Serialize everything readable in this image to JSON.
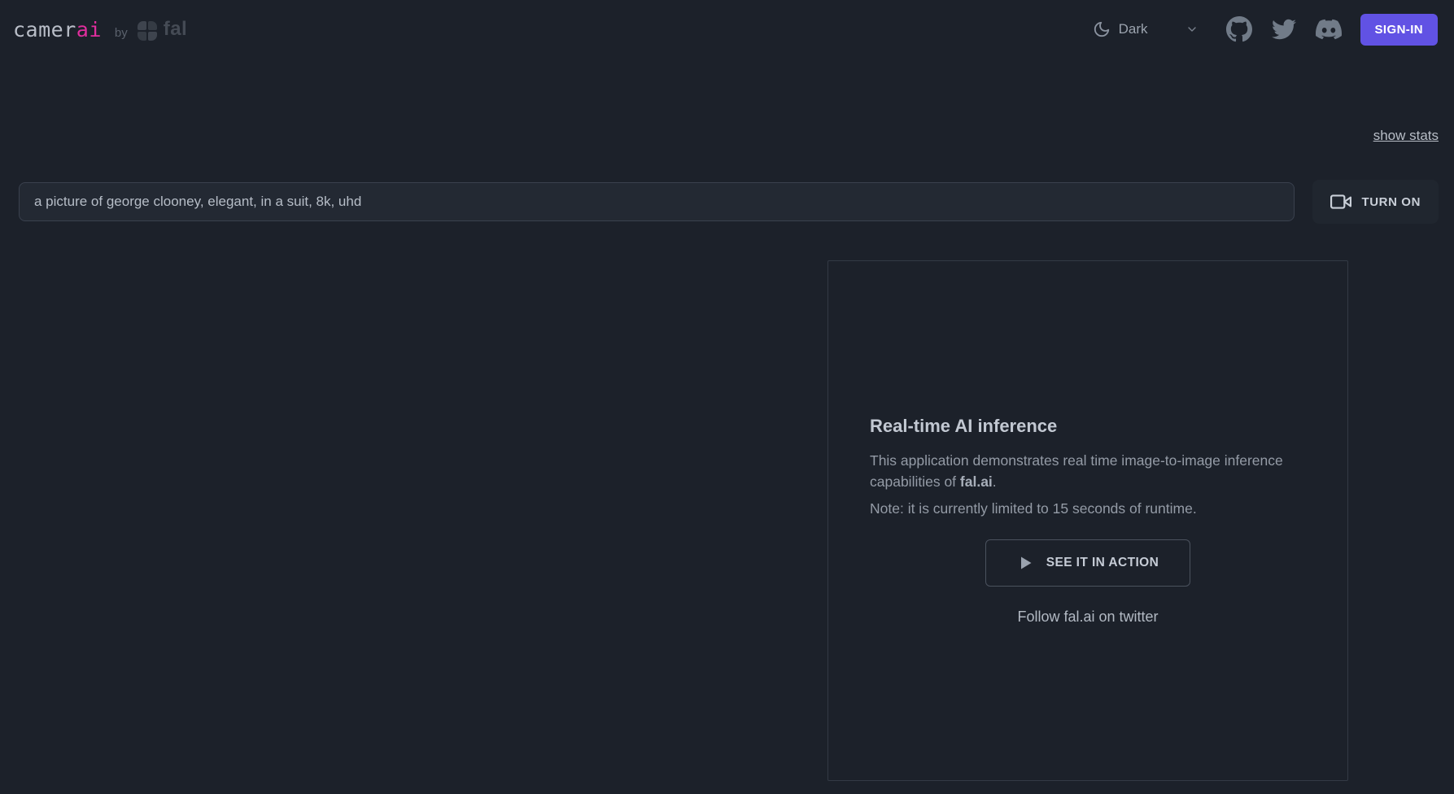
{
  "colors": {
    "page_background": "#1c212a",
    "accent_pink": "#e12e9e",
    "signin_purple": "#6152e4",
    "input_background": "#232933",
    "subtle_border": "#333a45"
  },
  "navbar": {
    "brand": {
      "name_primary": "camer",
      "name_accent": "ai",
      "by_label": "by",
      "partner_wordmark": "fal"
    },
    "theme_toggle": {
      "icon": "moon-crescent",
      "label": "Dark",
      "expander_icon": "chevron-down"
    },
    "social_icons": {
      "github": "github-logo",
      "twitter": "twitter-bird",
      "discord": "discord-logo"
    },
    "signin_button_label": "SIGN-IN"
  },
  "toolbar": {
    "show_stats_link": "show stats",
    "prompt_input": {
      "value": "a picture of george clooney, elegant, in a suit, 8k, uhd"
    },
    "turn_on_button": {
      "icon": "video-camera",
      "label": "TURN ON"
    }
  },
  "info_card": {
    "title": "Real-time AI inference",
    "description": {
      "text_before": "This application demonstrates real time image-to-image inference capabilities of ",
      "bold_text": "fal.ai",
      "text_after": "."
    },
    "note": "Note: it is currently limited to 15 seconds of runtime.",
    "cta_button": {
      "icon": "play-triangle",
      "label": "SEE IT IN ACTION"
    },
    "follow_link": "Follow fal.ai on twitter"
  }
}
